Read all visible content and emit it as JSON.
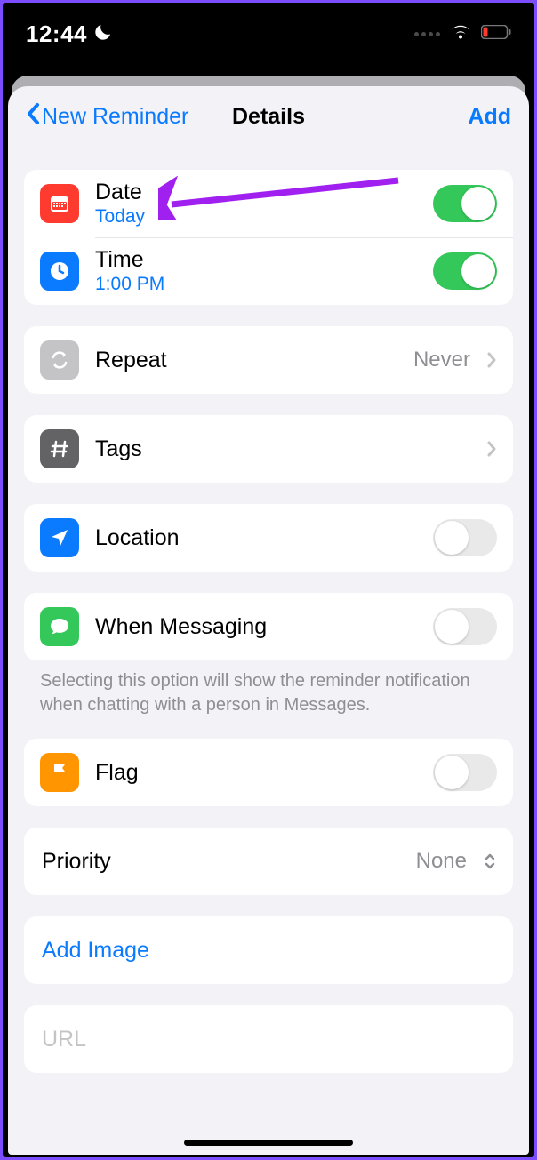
{
  "statusbar": {
    "time": "12:44"
  },
  "nav": {
    "back_label": "New Reminder",
    "title": "Details",
    "action": "Add"
  },
  "date_row": {
    "title": "Date",
    "value": "Today",
    "on": true
  },
  "time_row": {
    "title": "Time",
    "value": "1:00 PM",
    "on": true
  },
  "repeat": {
    "title": "Repeat",
    "value": "Never"
  },
  "tags": {
    "title": "Tags"
  },
  "location": {
    "title": "Location",
    "on": false
  },
  "messaging": {
    "title": "When Messaging",
    "on": false,
    "note": "Selecting this option will show the reminder notification when chatting with a person in Messages."
  },
  "flag": {
    "title": "Flag",
    "on": false
  },
  "priority": {
    "title": "Priority",
    "value": "None"
  },
  "add_image": {
    "title": "Add Image"
  },
  "url": {
    "placeholder": "URL"
  },
  "colors": {
    "accent": "#0a7aff",
    "date_icon": "#ff3b30",
    "time_icon": "#0a7aff",
    "repeat_icon": "#c4c4c6",
    "tags_icon": "#636366",
    "location_icon": "#0a7aff",
    "messaging_icon": "#34c759",
    "flag_icon": "#ff9500"
  }
}
